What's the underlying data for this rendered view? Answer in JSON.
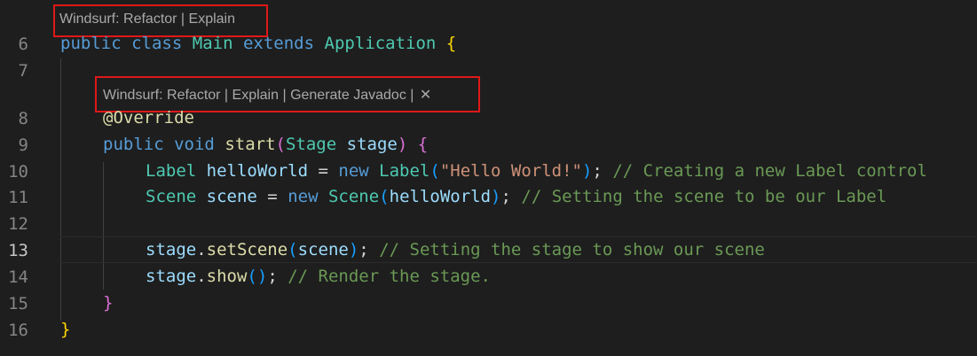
{
  "codelens_top": {
    "refactor": "Windsurf: Refactor",
    "sep1": " | ",
    "explain": "Explain"
  },
  "codelens_inner": {
    "refactor": "Windsurf: Refactor",
    "sep1": " | ",
    "explain": "Explain",
    "sep2": " | ",
    "javadoc": "Generate Javadoc",
    "sep3": " | ",
    "close": "✕"
  },
  "line_numbers": [
    "6",
    "7",
    "8",
    "9",
    "10",
    "11",
    "12",
    "13",
    "14",
    "15",
    "16"
  ],
  "code": {
    "l6": {
      "public": "public",
      "class": "class",
      "Main": "Main",
      "extends": "extends",
      "Application": "Application",
      "brace": "{"
    },
    "l8": {
      "override": "@Override"
    },
    "l9": {
      "public": "public",
      "void": "void",
      "start": "start",
      "lp": "(",
      "Stage": "Stage",
      "stage": "stage",
      "rp": ")",
      "brace": "{"
    },
    "l10": {
      "Label": "Label",
      "helloWorld": "helloWorld",
      "eq": " = ",
      "new": "new",
      "Label2": "Label",
      "lp": "(",
      "str": "\"Hello World!\"",
      "rp": ")",
      "semi": ";",
      "comment": "// Creating a new Label control"
    },
    "l11": {
      "Scene": "Scene",
      "scene": "scene",
      "eq": " = ",
      "new": "new",
      "Scene2": "Scene",
      "lp": "(",
      "helloWorld": "helloWorld",
      "rp": ")",
      "semi": ";",
      "comment": "// Setting the scene to be our Label"
    },
    "l13": {
      "stage": "stage",
      "dot": ".",
      "setScene": "setScene",
      "lp": "(",
      "scene": "scene",
      "rp": ")",
      "semi": ";",
      "comment": "// Setting the stage to show our scene"
    },
    "l14": {
      "stage": "stage",
      "dot": ".",
      "show": "show",
      "parens": "()",
      "semi": ";",
      "comment": "// Render the stage."
    },
    "l15": {
      "brace": "}"
    },
    "l16": {
      "brace": "}"
    }
  }
}
